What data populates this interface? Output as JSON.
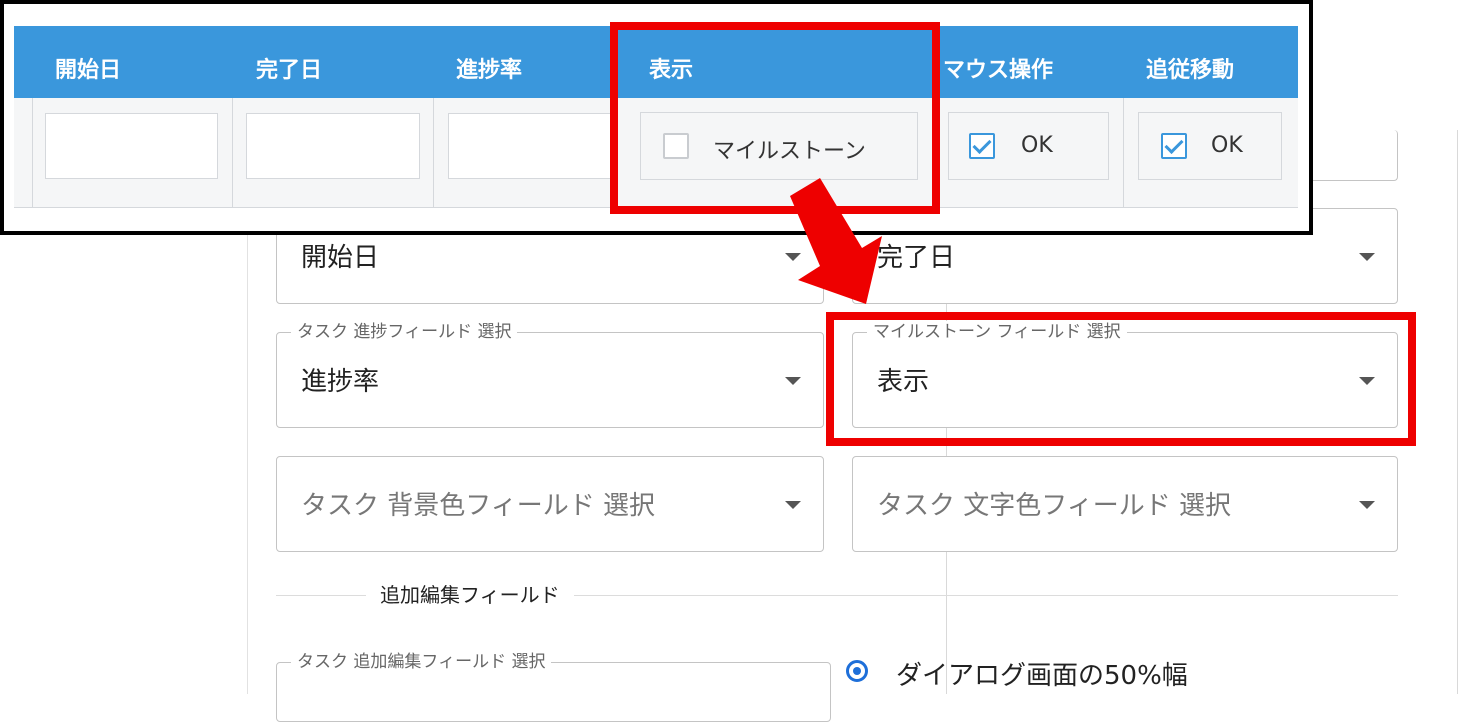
{
  "table_headers": [
    "開始日",
    "完了日",
    "進捗率",
    "表示",
    "マウス操作",
    "追従移動"
  ],
  "milestone_checkbox": {
    "label": "マイルストーン",
    "checked": false
  },
  "mouse_checkbox": {
    "label": "OK",
    "checked": true
  },
  "follow_checkbox": {
    "label": "OK",
    "checked": true
  },
  "fields": {
    "start_date": {
      "value": "開始日"
    },
    "end_date": {
      "value": "完了日"
    },
    "progress": {
      "legend": "タスク 進捗フィールド 選択",
      "value": "進捗率"
    },
    "milestone": {
      "legend": "マイルストーン フィールド 選択",
      "value": "表示"
    },
    "bg_color": {
      "placeholder": "タスク 背景色フィールド 選択"
    },
    "text_color": {
      "placeholder": "タスク 文字色フィールド 選択"
    },
    "extra_edit": {
      "legend": "タスク 追加編集フィールド 選択"
    }
  },
  "section_title": "追加編集フィールド",
  "dialog_width_option": "ダイアログ画面の50%幅",
  "colors": {
    "header_blue": "#3a97dc",
    "highlight_red": "#ee0000",
    "radio_blue": "#1e6fd9"
  }
}
